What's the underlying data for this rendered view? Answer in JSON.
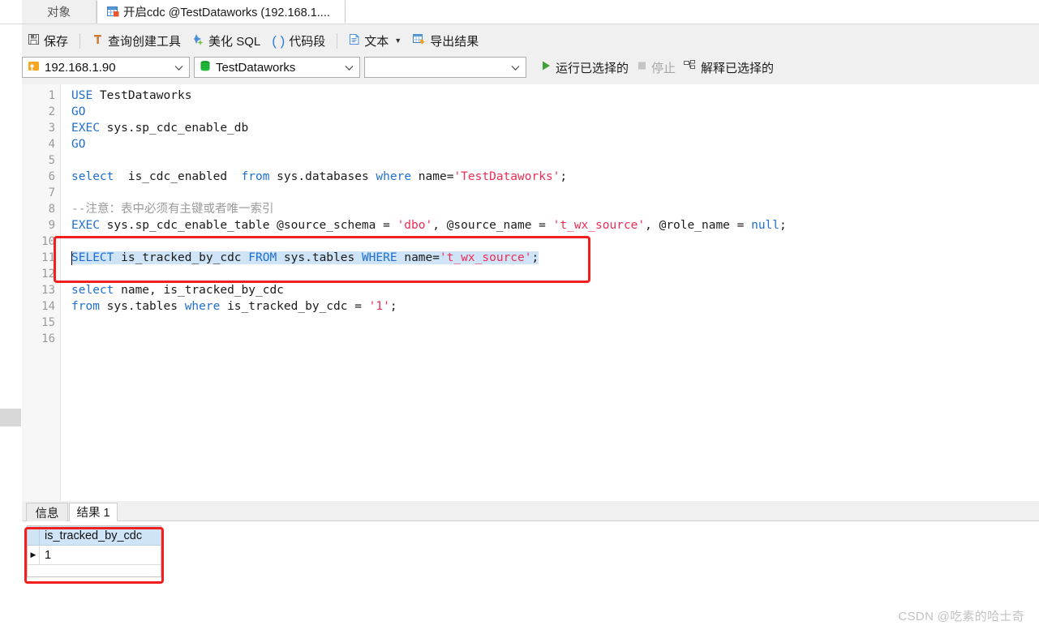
{
  "window": {
    "tabs": [
      {
        "label": "对象",
        "icon": "objects-icon",
        "active": false
      },
      {
        "label": "开启cdc @TestDataworks (192.168.1....",
        "icon": "query-tab-icon",
        "active": true
      }
    ]
  },
  "toolbar": {
    "save_label": "保存",
    "query_builder_label": "查询创建工具",
    "beautify_label": "美化 SQL",
    "snippet_label": "代码段",
    "text_label": "文本",
    "export_label": "导出结果",
    "icons": {
      "save": "save-icon",
      "query_builder": "query-builder-icon",
      "beautify": "beautify-icon",
      "snippet": "snippet-parens-icon",
      "text": "text-document-icon",
      "text_caret": "chevron-down-icon",
      "export": "export-results-icon"
    }
  },
  "connection_bar": {
    "host": "192.168.1.90",
    "host_icon": "server-connection-icon",
    "database": "TestDataworks",
    "database_icon": "database-icon",
    "schema": "",
    "chevron_icon": "chevron-down-icon",
    "run_selected_label": "运行已选择的",
    "run_icon": "play-triangle-icon",
    "stop_label": "停止",
    "stop_icon": "stop-square-icon",
    "stop_disabled": true,
    "explain_label": "解释已选择的",
    "explain_icon": "explain-plan-icon"
  },
  "editor": {
    "line_numbers": [
      1,
      2,
      3,
      4,
      5,
      6,
      7,
      8,
      9,
      10,
      11,
      12,
      13,
      14,
      15,
      16
    ],
    "lines": [
      {
        "n": 1,
        "text": "USE TestDataworks"
      },
      {
        "n": 2,
        "text": "GO"
      },
      {
        "n": 3,
        "text": "EXEC sys.sp_cdc_enable_db"
      },
      {
        "n": 4,
        "text": "GO"
      },
      {
        "n": 5,
        "text": ""
      },
      {
        "n": 6,
        "text": "select  is_cdc_enabled  from sys.databases where name='TestDataworks';"
      },
      {
        "n": 7,
        "text": ""
      },
      {
        "n": 8,
        "text": "--注意：表中必须有主键或者唯一索引"
      },
      {
        "n": 9,
        "text": "EXEC sys.sp_cdc_enable_table @source_schema = 'dbo', @source_name = 't_wx_source', @role_name = null;"
      },
      {
        "n": 10,
        "text": ""
      },
      {
        "n": 11,
        "text": "SELECT is_tracked_by_cdc FROM sys.tables WHERE name='t_wx_source';"
      },
      {
        "n": 12,
        "text": ""
      },
      {
        "n": 13,
        "text": "select name, is_tracked_by_cdc"
      },
      {
        "n": 14,
        "text": "from sys.tables where is_tracked_by_cdc = '1';"
      },
      {
        "n": 15,
        "text": ""
      },
      {
        "n": 16,
        "text": ""
      }
    ],
    "selected_line": 11,
    "selection_text": "SELECT is_tracked_by_cdc FROM sys.tables WHERE name='t_wx_source';"
  },
  "results": {
    "tabs": [
      {
        "label": "信息",
        "active": false
      },
      {
        "label": "结果 1",
        "active": true
      }
    ],
    "grid": {
      "columns": [
        "is_tracked_by_cdc"
      ],
      "rows": [
        [
          "1"
        ]
      ],
      "current_row_marker": "▶"
    }
  },
  "annotations": {
    "highlight_color": "#f21f1f",
    "selection_color": "#cfe4f7"
  },
  "watermark": "CSDN @吃素的哈士奇"
}
